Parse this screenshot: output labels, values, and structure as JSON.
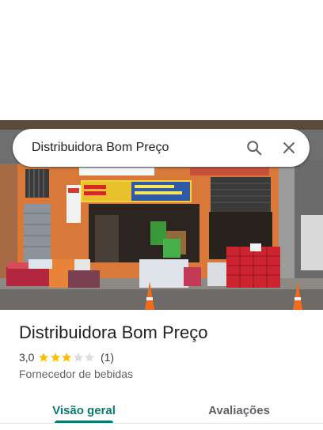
{
  "search": {
    "query": "Distribuidora Bom Preço"
  },
  "place": {
    "name": "Distribuidora Bom Preço",
    "rating": "3,0",
    "rating_value": 3,
    "review_count": "(1)",
    "category": "Fornecedor de bebidas"
  },
  "tabs": [
    {
      "label": "Visão geral",
      "active": true
    },
    {
      "label": "Avaliações",
      "active": false
    }
  ],
  "colors": {
    "accent": "#0b7a6f",
    "star": "#fbbc04",
    "star_empty": "#dadce0"
  }
}
